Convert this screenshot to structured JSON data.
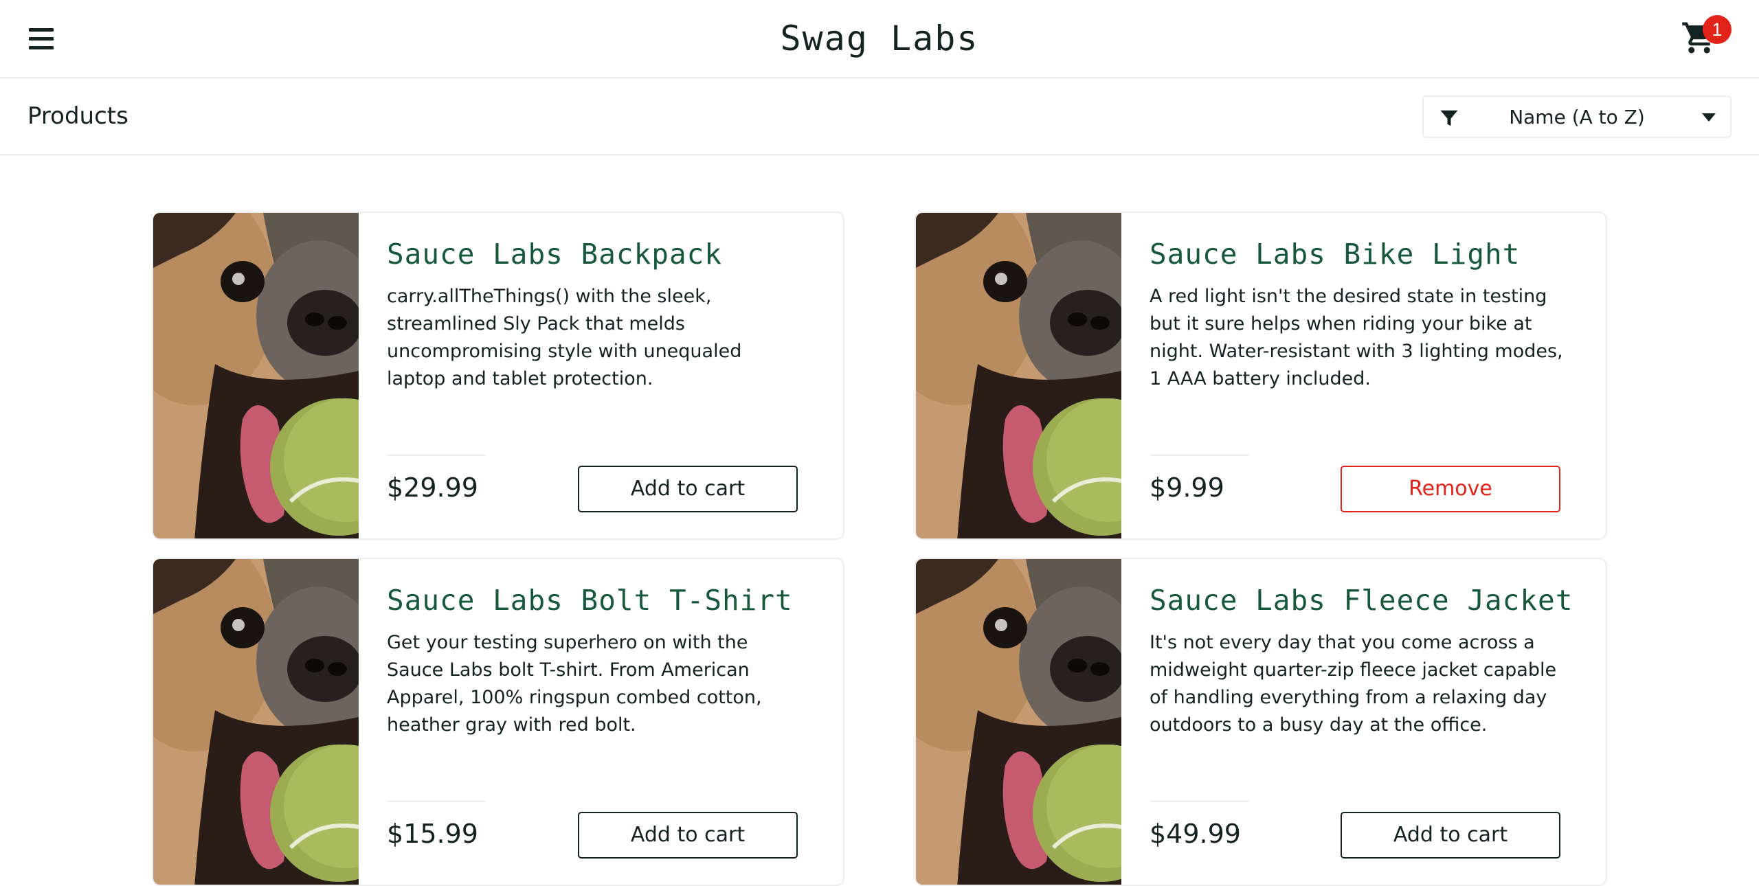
{
  "app": {
    "title": "Swag Labs",
    "cart_count": "1"
  },
  "subheader": {
    "title": "Products",
    "sort_selected": "Name (A to Z)"
  },
  "products": [
    {
      "name": "Sauce Labs Backpack",
      "description": "carry.allTheThings() with the sleek, streamlined Sly Pack that melds uncompromising style with unequaled laptop and tablet protection.",
      "price": "$29.99",
      "button_label": "Add to cart",
      "button_state": "add"
    },
    {
      "name": "Sauce Labs Bike Light",
      "description": "A red light isn't the desired state in testing but it sure helps when riding your bike at night. Water-resistant with 3 lighting modes, 1 AAA battery included.",
      "price": "$9.99",
      "button_label": "Remove",
      "button_state": "remove"
    },
    {
      "name": "Sauce Labs Bolt T-Shirt",
      "description": "Get your testing superhero on with the Sauce Labs bolt T-shirt. From American Apparel, 100% ringspun combed cotton, heather gray with red bolt.",
      "price": "$15.99",
      "button_label": "Add to cart",
      "button_state": "add"
    },
    {
      "name": "Sauce Labs Fleece Jacket",
      "description": "It's not every day that you come across a midweight quarter-zip fleece jacket capable of handling everything from a relaxing day outdoors to a busy day at the office.",
      "price": "$49.99",
      "button_label": "Add to cart",
      "button_state": "add"
    }
  ],
  "icons": {
    "menu": "hamburger-menu-icon",
    "cart": "shopping-cart-icon",
    "filter": "filter-icon",
    "caret": "caret-down-icon",
    "product_image": "pug-photo"
  },
  "colors": {
    "accent_green": "#18583a",
    "text_dark": "#132322",
    "badge_red": "#e2231a",
    "border_light": "#ededed"
  }
}
